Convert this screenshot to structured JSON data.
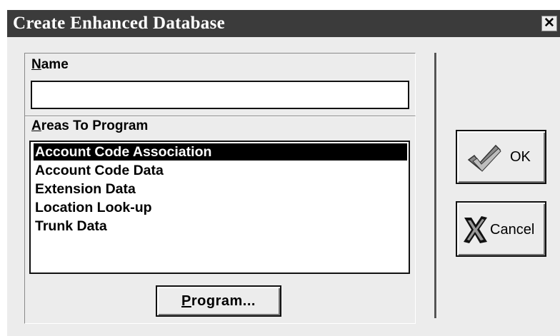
{
  "window": {
    "title": "Create Enhanced Database",
    "close_glyph": "✕"
  },
  "name_group": {
    "label_accel": "N",
    "label_rest": "ame",
    "input_value": ""
  },
  "areas_group": {
    "label_accel": "A",
    "label_rest": "reas To Program",
    "items": [
      "Account Code Association",
      "Account Code Data",
      "Extension Data",
      "Location Look-up",
      "Trunk Data"
    ],
    "selected_index": 0
  },
  "program_button": {
    "label_accel": "P",
    "label_rest": "rogram..."
  },
  "ok_button": {
    "label": "OK",
    "icon": "checkmark-icon",
    "icon_color": "#8a8a8a"
  },
  "cancel_button": {
    "label": "Cancel",
    "icon": "x-cancel-icon",
    "icon_color": "#111111"
  },
  "colors": {
    "title_bar": "#3b3b3b",
    "dialog_bg": "#ececec",
    "selection_bg": "#000000"
  }
}
